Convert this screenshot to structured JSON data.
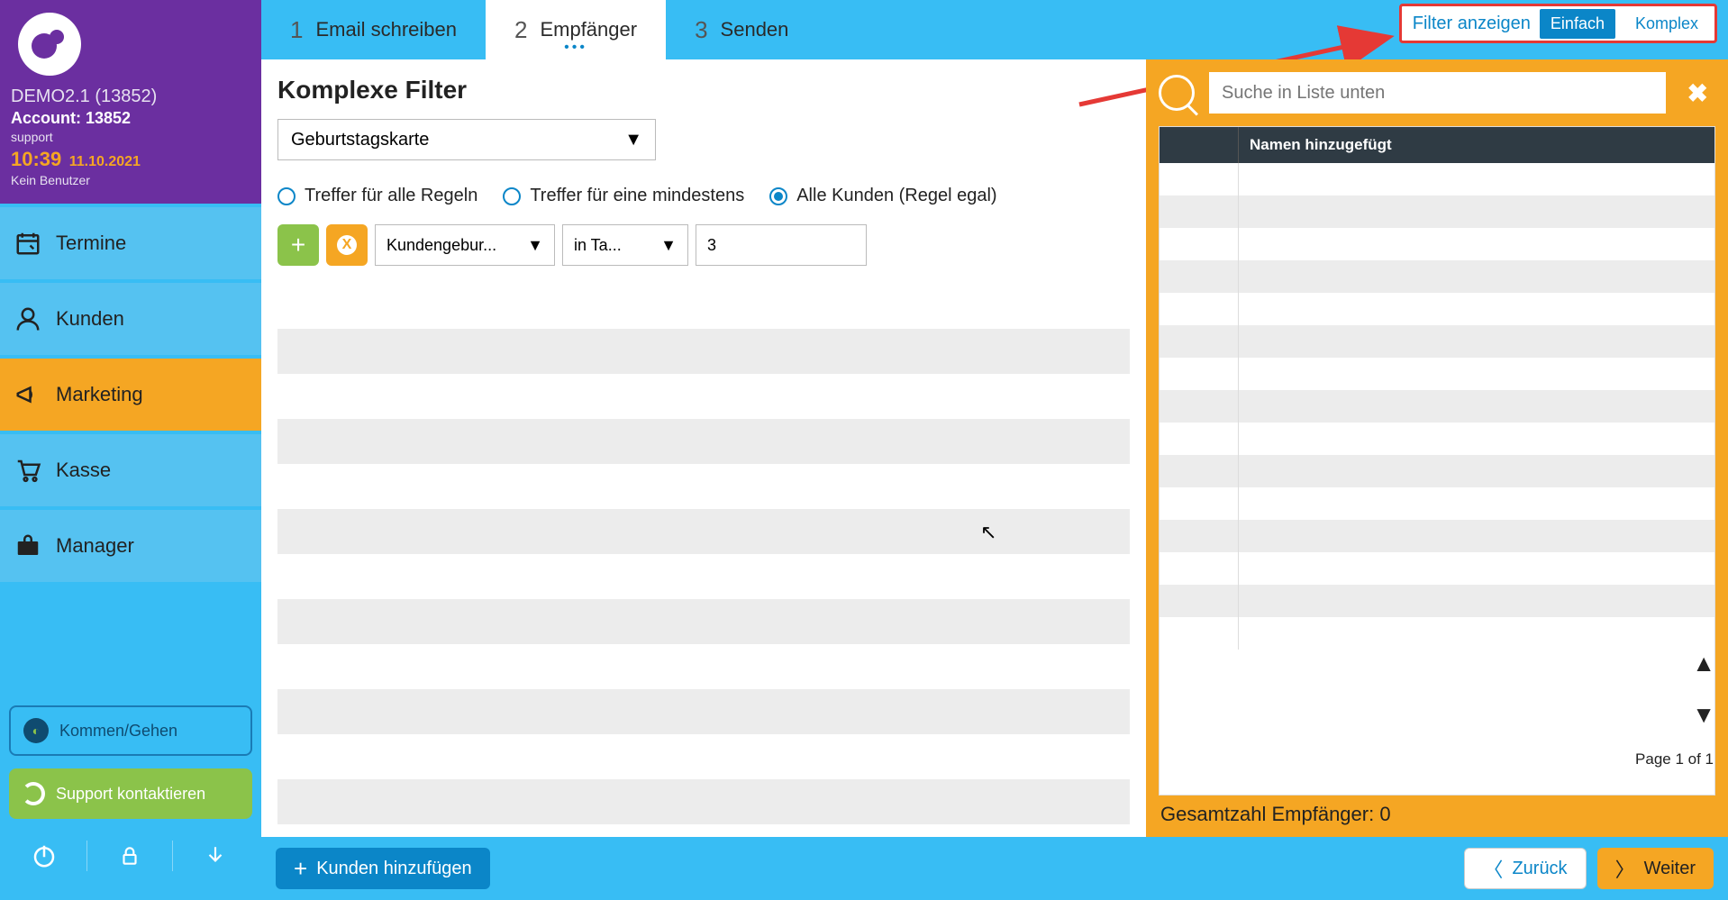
{
  "sidebar": {
    "account_label": "DEMO2.1 (13852)",
    "account_id_label": "Account: 13852",
    "role": "support",
    "time": "10:39",
    "date": "11.10.2021",
    "no_user": "Kein Benutzer",
    "nav": {
      "termine": "Termine",
      "kunden": "Kunden",
      "marketing": "Marketing",
      "kasse": "Kasse",
      "manager": "Manager"
    },
    "kommen_gehen": "Kommen/Gehen",
    "support_contact": "Support kontaktieren"
  },
  "steps": {
    "s1": {
      "num": "1",
      "label": "Email schreiben"
    },
    "s2": {
      "num": "2",
      "label": "Empfänger"
    },
    "s3": {
      "num": "3",
      "label": "Senden"
    }
  },
  "filter_toggle": {
    "label": "Filter anzeigen",
    "simple": "Einfach",
    "complex": "Komplex"
  },
  "main": {
    "heading": "Komplexe Filter",
    "template_select": "Geburtstagskarte",
    "radios": {
      "all_rules": "Treffer für alle Regeln",
      "at_least_one": "Treffer für eine mindestens",
      "all_customers": "Alle Kunden (Regel egal)"
    },
    "rule": {
      "field": "Kundengebur...",
      "op": "in Ta...",
      "value": "3"
    }
  },
  "right": {
    "search_placeholder": "Suche in Liste unten",
    "col_names": "Namen hinzugefügt",
    "page_of": "Page 1 of 1",
    "total_label": "Gesamtzahl Empfänger: 0"
  },
  "footer": {
    "add_customers": "Kunden hinzufügen",
    "back": "Zurück",
    "next": "Weiter"
  }
}
